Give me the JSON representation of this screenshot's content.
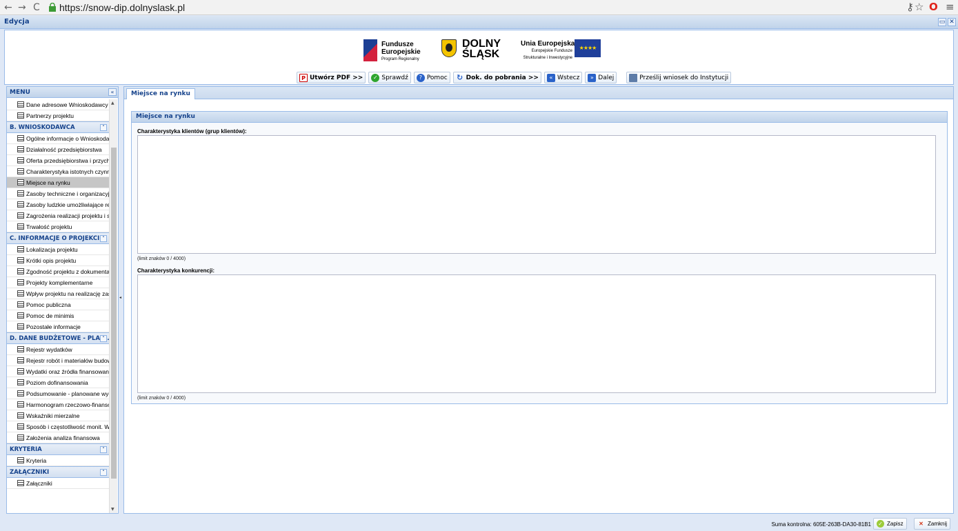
{
  "browser": {
    "url": "https://snow-dip.dolnyslask.pl"
  },
  "window": {
    "title": "Edycja"
  },
  "logos": {
    "fe_line1": "Fundusze",
    "fe_line2": "Europejskie",
    "fe_line3": "Program Regionalny",
    "ds_line1": "DOLNY",
    "ds_line2": "ŚLĄSK",
    "ue_line1": "Unia Europejska",
    "ue_line2": "Europejskie Fundusze",
    "ue_line3": "Strukturalne i Inwestycyjne"
  },
  "toolbar": {
    "pdf": "Utwórz PDF >>",
    "check": "Sprawdź",
    "help": "Pomoc",
    "download": "Dok. do pobrania >>",
    "back": "Wstecz",
    "next": "Dalej",
    "send": "Prześlij wniosek do Instytucji"
  },
  "sidebar": {
    "title": "MENU",
    "top_items": [
      "Dane adresowe Wnioskodawcy",
      "Partnerzy projektu"
    ],
    "groups": [
      {
        "title": "B. WNIOSKODAWCA",
        "items": [
          "Ogólne informacje o Wnioskodawcy",
          "Działalność przedsiębiorstwa",
          "Oferta przedsiębiorstwa i przychody",
          "Charakterystyka istotnych czynników",
          "Miejsce na rynku",
          "Zasoby techniczne i organizacyjne",
          "Zasoby ludzkie umożliwiające realizację",
          "Zagrożenia realizacji projektu i sposoby",
          "Trwałość projektu"
        ]
      },
      {
        "title": "C. INFORMACJE O PROJEKCIE",
        "items": [
          "Lokalizacja projektu",
          "Krótki opis projektu",
          "Zgodność projektu z dokumentami",
          "Projekty komplementarne",
          "Wpływ projektu na realizację zasad",
          "Pomoc publiczna",
          "Pomoc de minimis",
          "Pozostałe informacje"
        ]
      },
      {
        "title": "D. DANE BUDŻETOWE - PLAN...",
        "items": [
          "Rejestr wydatków",
          "Rejestr robót i materiałów budowlanych",
          "Wydatki oraz źródła finansowania",
          "Poziom dofinansowania",
          "Podsumowanie - planowane wydatki",
          "Harmonogram rzeczowo-finansowy",
          "Wskaźniki mierzalne",
          "Sposób i częstotliwość monit. Wsk.",
          "Założenia analiza finansowa"
        ]
      },
      {
        "title": "KRYTERIA",
        "items": [
          "Kryteria"
        ]
      },
      {
        "title": "ZAŁĄCZNIKI",
        "items": [
          "Załączniki"
        ]
      }
    ],
    "selected": "Miejsce na rynku"
  },
  "main": {
    "tab": "Miejsce na rynku",
    "fieldset_title": "Miejsce na rynku",
    "field1_label": "Charakterystyka klientów (grup klientów):",
    "field1_value": "",
    "field1_limit": "(limit znaków 0 / 4000)",
    "field2_label": "Charakterystyka konkurencji:",
    "field2_value": "",
    "field2_limit": "(limit znaków 0 / 4000)"
  },
  "status": {
    "checksum": "Suma kontrolna: 605E-263B-DA30-81B1",
    "save": "Zapisz",
    "close": "Zamknij"
  }
}
